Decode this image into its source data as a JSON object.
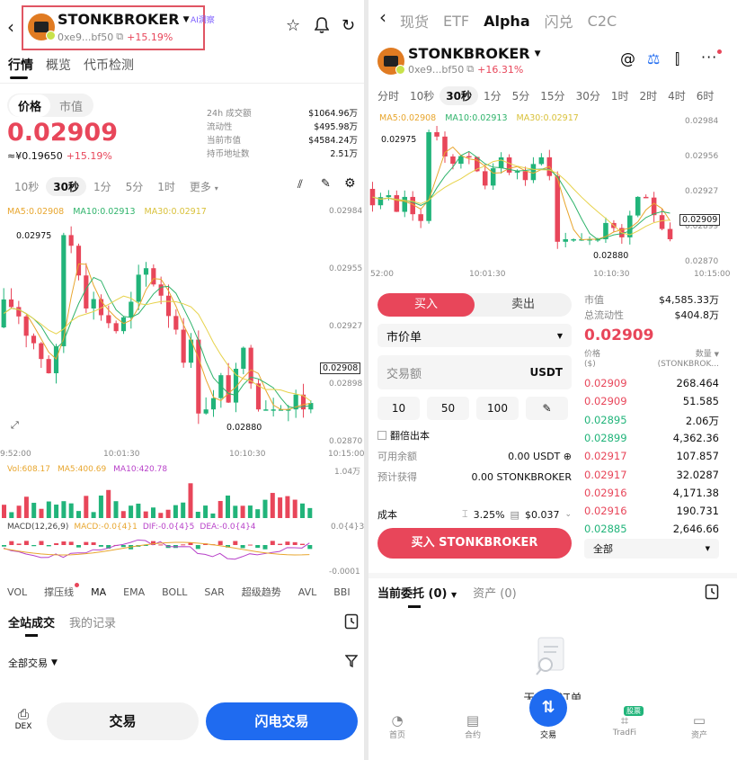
{
  "colors": {
    "up": "#e8465a",
    "down": "#21b47a",
    "brand": "#1f6bf0",
    "ma5": "#e8a62e",
    "ma10": "#2fb36b",
    "ma30": "#e7d24a"
  },
  "left": {
    "header": {
      "token": "STONKBROKER",
      "address": "0xe9...bf50",
      "change": "+15.19%",
      "ai_badge": "AI洞察"
    },
    "tabs": [
      "行情",
      "概览",
      "代币检测"
    ],
    "price_tabs": [
      "价格",
      "市值"
    ],
    "price": "0.02909",
    "price_cny": "≈¥0.19650",
    "price_change": "+15.19%",
    "stats": [
      {
        "label": "24h 成交额",
        "value": "$1064.96万"
      },
      {
        "label": "流动性",
        "value": "$495.98万"
      },
      {
        "label": "当前市值",
        "value": "$4584.24万"
      },
      {
        "label": "持币地址数",
        "value": "2.51万"
      }
    ],
    "intervals": [
      "10秒",
      "30秒",
      "1分",
      "5分",
      "1时",
      "更多"
    ],
    "ma_line": {
      "ma5": "MA5:0.02908",
      "ma10": "MA10:0.02913",
      "ma30": "MA30:0.02917"
    },
    "y_ticks": [
      "0.02984",
      "0.02955",
      "0.02927",
      "0.02898",
      "0.02870"
    ],
    "high_label": "0.02975",
    "low_label": "0.02880",
    "current_label": "0.02908",
    "x_ticks": [
      "9:52:00",
      "10:01:30",
      "10:10:30",
      "10:15:00"
    ],
    "vol_line": {
      "vol": "Vol:608.17",
      "ma5": "MA5:400.69",
      "ma10": "MA10:420.78"
    },
    "vol_max": "1.04万",
    "macd_line": {
      "macd": "MACD(12,26,9)",
      "val": "MACD:-0.0{4}1",
      "dif": "DIF:-0.0{4}5",
      "dea": "DEA:-0.0{4}4"
    },
    "macd_top": "0.0{4}3",
    "macd_bottom": "-0.0001",
    "indicators": [
      "VOL",
      "撑压线",
      "MA",
      "EMA",
      "BOLL",
      "SAR",
      "超级趋势",
      "AVL",
      "BBI"
    ],
    "trade_tabs": [
      "全站成交",
      "我的记录"
    ],
    "filter": "全部交易",
    "dex_label": "DEX",
    "btn_trade": "交易",
    "btn_flash": "闪电交易"
  },
  "right": {
    "top_tabs": [
      "现货",
      "ETF",
      "Alpha",
      "闪兑",
      "C2C"
    ],
    "token": "STONKBROKER",
    "address": "0xe9...bf50",
    "change": "+16.31%",
    "intervals": [
      "分时",
      "10秒",
      "30秒",
      "1分",
      "5分",
      "15分",
      "30分",
      "1时",
      "2时",
      "4时",
      "6时"
    ],
    "ma_line": {
      "ma5": "MA5:0.02908",
      "ma10": "MA10:0.02913",
      "ma30": "MA30:0.02917"
    },
    "y_ticks": [
      "0.02984",
      "0.02956",
      "0.02927",
      "0.02899",
      "0.02870"
    ],
    "high_label": "0.02975",
    "low_label": "0.02880",
    "current_label": "0.02909",
    "x_ticks": [
      "52:00",
      "10:01:30",
      "10:10:30",
      "10:15:00"
    ],
    "buy": "买入",
    "sell": "卖出",
    "order_type": "市价单",
    "amount_placeholder": "交易额",
    "amount_unit": "USDT",
    "quick": [
      "10",
      "50",
      "100"
    ],
    "double_out": "翻倍出本",
    "avail_label": "可用余额",
    "avail_value": "0.00 USDT",
    "expect_label": "预计获得",
    "expect_value": "0.00 STONKBROKER",
    "cost_label": "成本",
    "cost_pct": "3.25%",
    "cost_usd": "$0.037",
    "buy_button": "买入 STONKBROKER",
    "market": {
      "cap_label": "市值",
      "cap_value": "$4,585.33万",
      "liq_label": "总流动性",
      "liq_value": "$404.8万"
    },
    "book_price": "0.02909",
    "book_head": {
      "price": "价格",
      "price_unit": "($)",
      "qty": "数量",
      "qty_unit": "(STONKBROK..."
    },
    "book": [
      {
        "p": "0.02909",
        "q": "268.464",
        "side": "up"
      },
      {
        "p": "0.02909",
        "q": "51.585",
        "side": "up"
      },
      {
        "p": "0.02895",
        "q": "2.06万",
        "side": "down"
      },
      {
        "p": "0.02899",
        "q": "4,362.36",
        "side": "down"
      },
      {
        "p": "0.02917",
        "q": "107.857",
        "side": "up"
      },
      {
        "p": "0.02917",
        "q": "32.0287",
        "side": "up"
      },
      {
        "p": "0.02916",
        "q": "4,171.38",
        "side": "up"
      },
      {
        "p": "0.02916",
        "q": "190.731",
        "side": "up"
      },
      {
        "p": "0.02885",
        "q": "2,646.66",
        "side": "down"
      }
    ],
    "book_filter": "全部",
    "orders_tab": "当前委托 (0)",
    "assets_tab": "资产 (0)",
    "empty_text": "无委托订单",
    "nav": [
      {
        "label": "首页",
        "icon": "home-icon"
      },
      {
        "label": "合约",
        "icon": "contract-icon"
      },
      {
        "label": "交易",
        "icon": "trade-icon"
      },
      {
        "label": "TradFi",
        "icon": "tradfi-icon",
        "badge": "股票"
      },
      {
        "label": "资产",
        "icon": "wallet-icon"
      }
    ]
  }
}
